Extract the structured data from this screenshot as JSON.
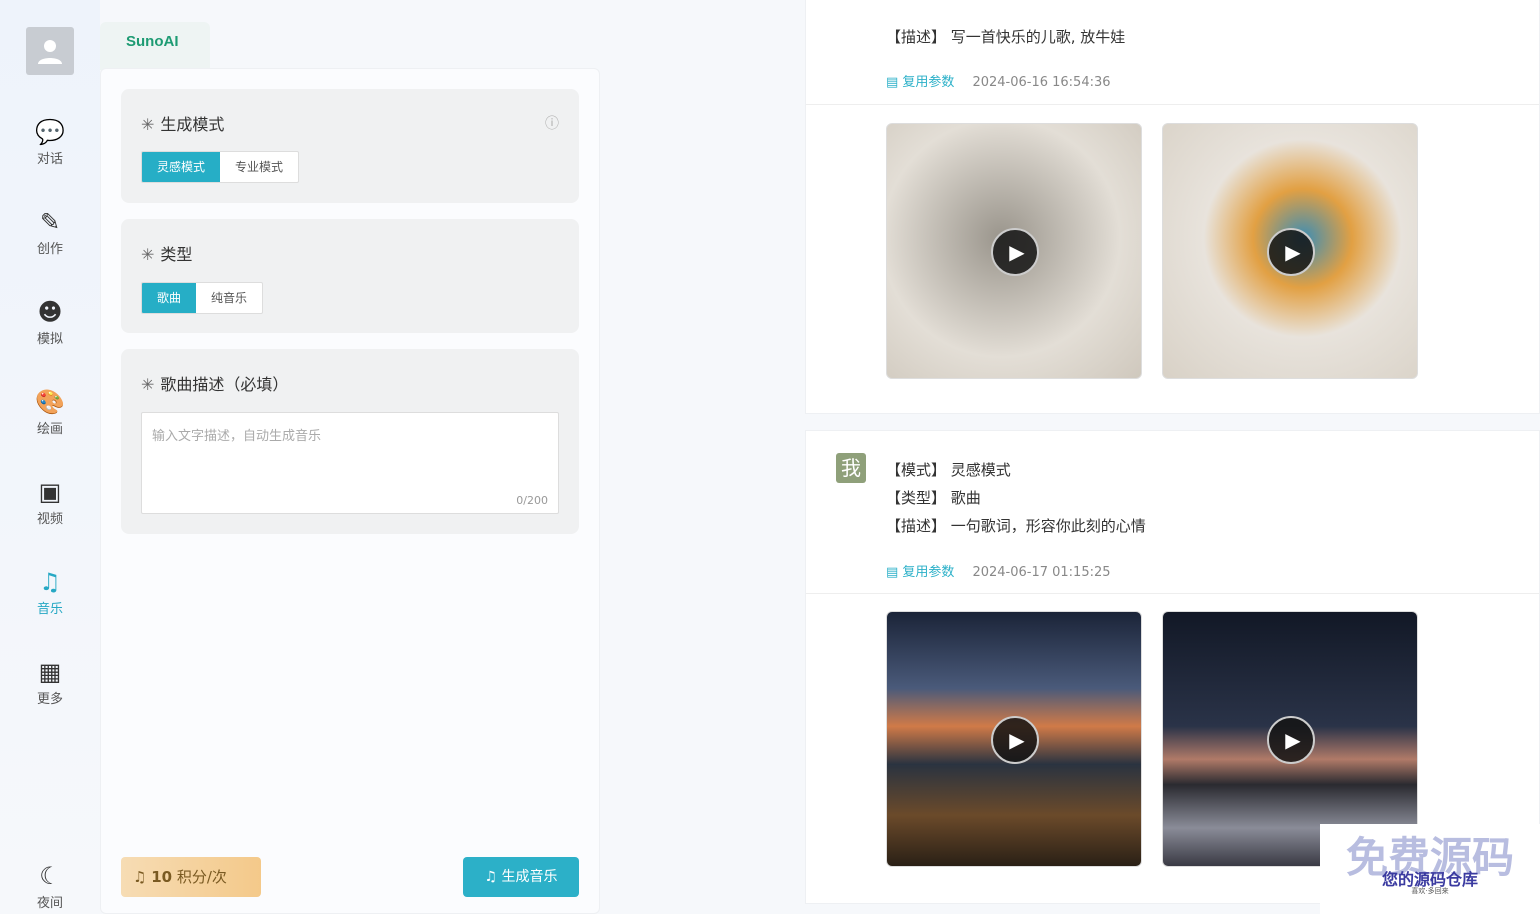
{
  "sidebar": {
    "items": [
      {
        "label": "对话",
        "icon": "chat-icon"
      },
      {
        "label": "创作",
        "icon": "feather-icon"
      },
      {
        "label": "模拟",
        "icon": "head-icon"
      },
      {
        "label": "绘画",
        "icon": "palette-icon"
      },
      {
        "label": "视频",
        "icon": "video-icon"
      },
      {
        "label": "音乐",
        "icon": "music-icon",
        "active": true
      },
      {
        "label": "更多",
        "icon": "grid-icon"
      }
    ],
    "night": "夜间"
  },
  "tab": "SunoAI",
  "form": {
    "mode_label": "生成模式",
    "modes": [
      "灵感模式",
      "专业模式"
    ],
    "type_label": "类型",
    "types": [
      "歌曲",
      "纯音乐"
    ],
    "desc_label": "歌曲描述（必填）",
    "desc_placeholder": "输入文字描述，自动生成音乐",
    "desc_count": "0/200",
    "cost_value": "10",
    "cost_unit": "积分/次",
    "generate": "生成音乐"
  },
  "feed": [
    {
      "desc": "【描述】 写一首快乐的儿歌, 放牛娃",
      "reuse": "复用参数",
      "time": "2024-06-16 16:54:36"
    },
    {
      "avatar": "我",
      "mode": "【模式】 灵感模式",
      "type": "【类型】 歌曲",
      "desc": "【描述】 一句歌词，形容你此刻的心情",
      "reuse": "复用参数",
      "time": "2024-06-17 01:15:25"
    }
  ],
  "watermark": {
    "big": "免费源码",
    "mid": "您的源码仓库",
    "small": "喜欢·多回来"
  },
  "colors": {
    "accent": "#26aec6",
    "brand": "#1e9b73"
  }
}
